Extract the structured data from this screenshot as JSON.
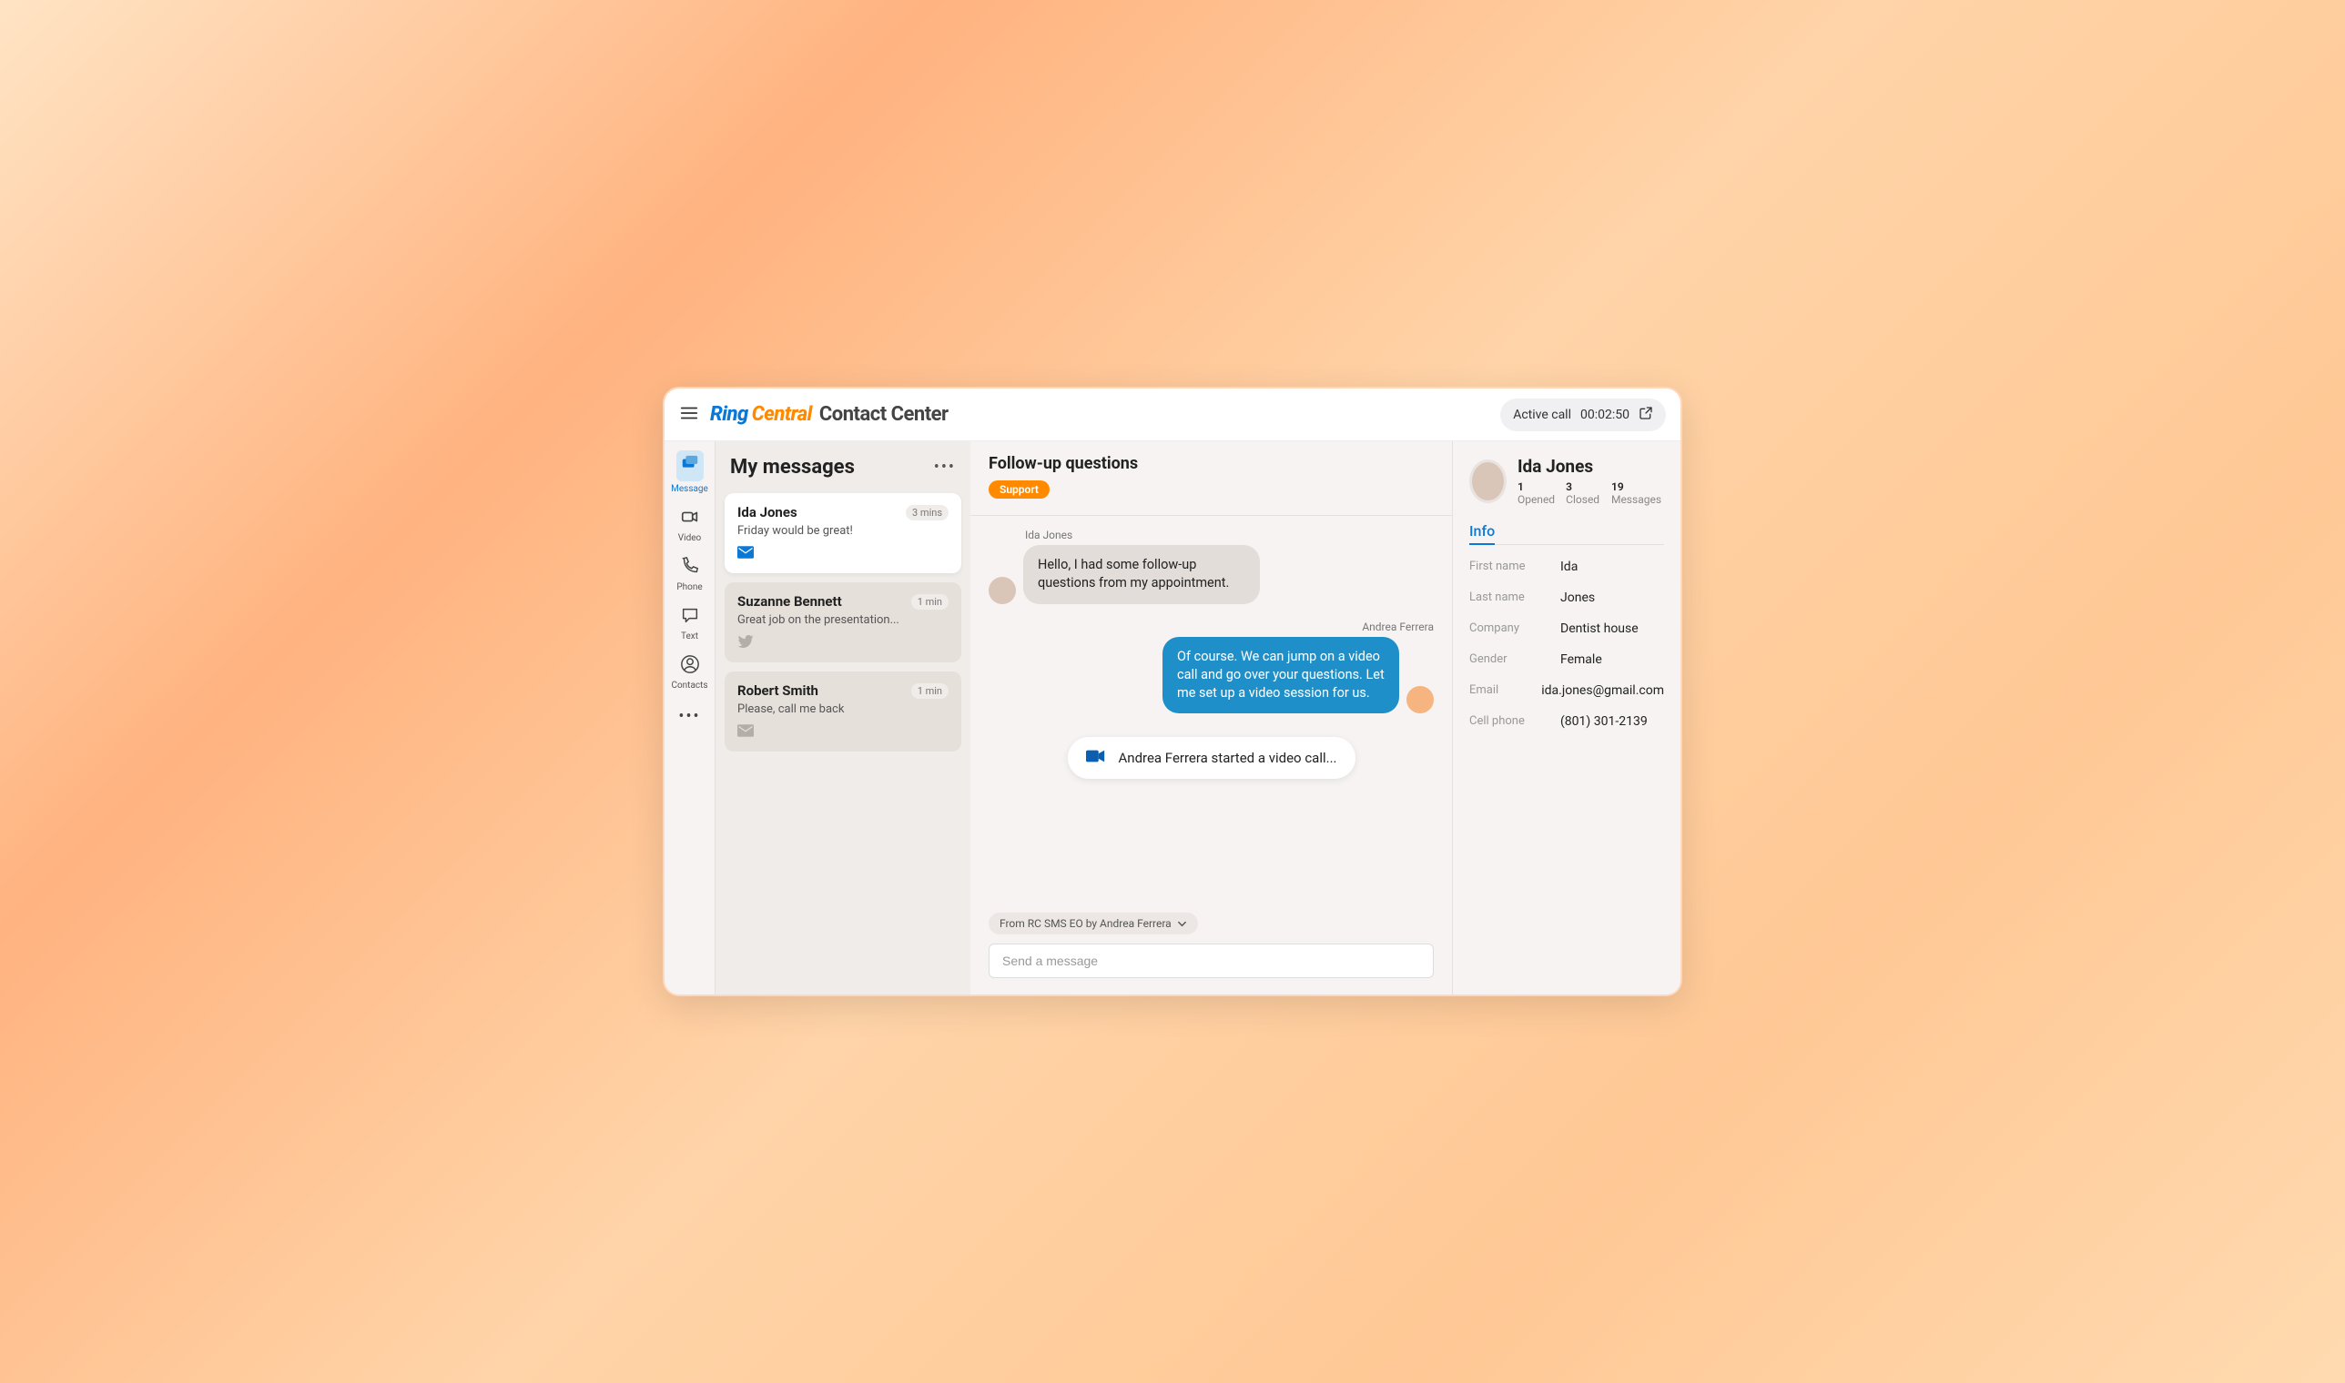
{
  "brand": {
    "ring": "Ring",
    "central": "Central",
    "product": "Contact Center"
  },
  "active_call": {
    "prefix": "Active call",
    "duration": "00:02:50"
  },
  "nav": {
    "message": "Message",
    "video": "Video",
    "phone": "Phone",
    "text": "Text",
    "contacts": "Contacts"
  },
  "messages": {
    "title": "My messages",
    "items": [
      {
        "name": "Ida Jones",
        "time": "3 mins",
        "preview": "Friday would be great!",
        "channel": "mail",
        "active": true
      },
      {
        "name": "Suzanne Bennett",
        "time": "1 min",
        "preview": "Great job on the presentation...",
        "channel": "twitter",
        "active": false
      },
      {
        "name": "Robert Smith",
        "time": "1 min",
        "preview": "Please, call me back",
        "channel": "mail-grey",
        "active": false
      }
    ]
  },
  "conversation": {
    "title": "Follow-up questions",
    "tag": "Support",
    "sender_in": "Ida Jones",
    "msg_in": "Hello, I had some follow-up questions  from my appointment.",
    "sender_out": "Andrea Ferrera",
    "msg_out": "Of course. We can jump on a video call and go over your questions. Let me set up a video session for us.",
    "video_event": "Andrea Ferrera started a video call...",
    "channel_line": "From RC SMS EO by Andrea Ferrera",
    "compose_placeholder": "Send a message"
  },
  "contact": {
    "name": "Ida Jones",
    "stats": [
      {
        "num": "1",
        "label": "Opened"
      },
      {
        "num": "3",
        "label": "Closed"
      },
      {
        "num": "19",
        "label": "Messages"
      }
    ],
    "tab": "Info",
    "fields": [
      {
        "label": "First name",
        "value": "Ida"
      },
      {
        "label": "Last name",
        "value": "Jones"
      },
      {
        "label": "Company",
        "value": "Dentist house"
      },
      {
        "label": "Gender",
        "value": "Female"
      },
      {
        "label": "Email",
        "value": "ida.jones@gmail.com"
      },
      {
        "label": "Cell phone",
        "value": "(801) 301-2139"
      }
    ]
  }
}
